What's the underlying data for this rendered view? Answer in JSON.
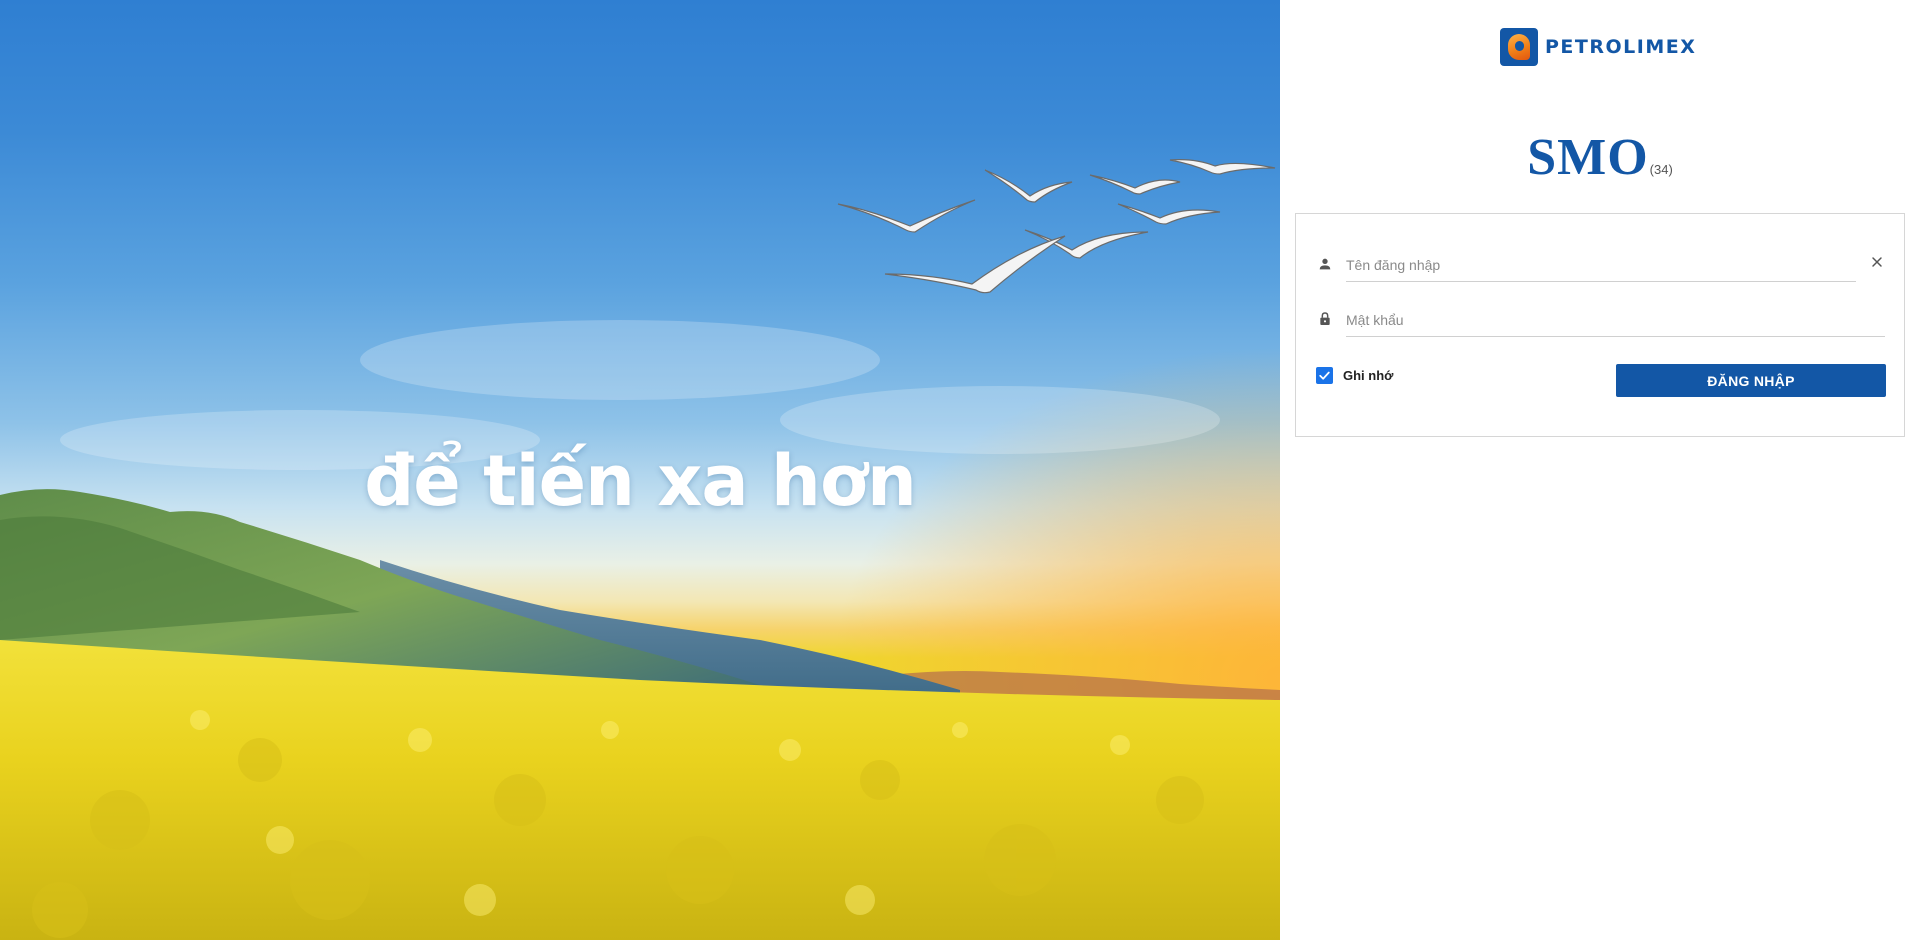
{
  "hero": {
    "slogan": "để tiến xa hơn"
  },
  "header": {
    "brand_name": "PETROLIMEX",
    "logo_icon": "petrolimex-logo-icon",
    "brand_color": "#1357a6"
  },
  "app": {
    "title": "SMO",
    "version": "(34)"
  },
  "login_form": {
    "username_placeholder": "Tên đăng nhập",
    "username_value": "",
    "password_placeholder": "Mật khẩu",
    "password_value": "",
    "remember_label": "Ghi nhớ",
    "remember_checked": true,
    "submit_label": "ĐĂNG NHẬP",
    "icons": {
      "username": "user-icon",
      "password": "lock-icon",
      "clear": "close-icon",
      "checkbox": "check-icon"
    }
  }
}
